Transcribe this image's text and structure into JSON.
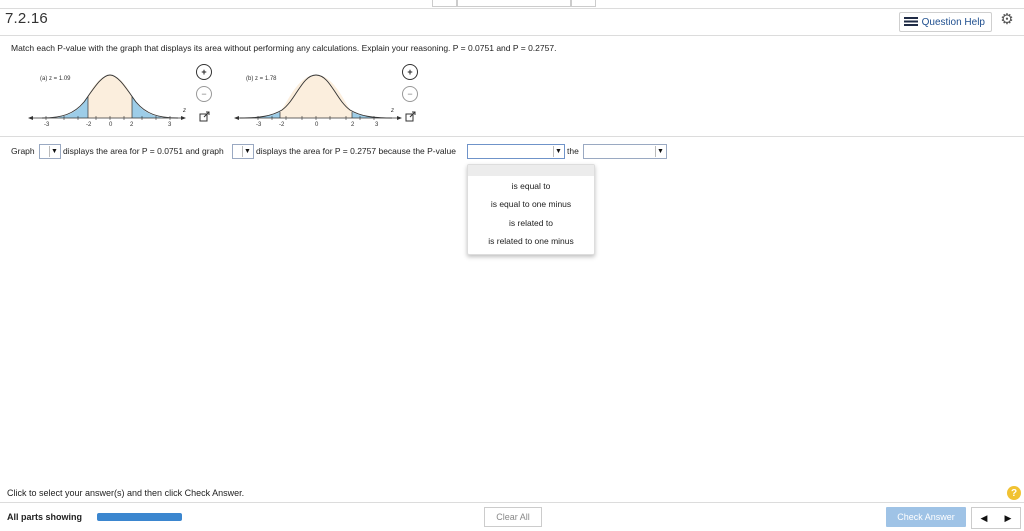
{
  "question": {
    "number": "7.2.16",
    "instruction": "Match each P-value with the graph that displays its area without performing any calculations. Explain your reasoning. P = 0.0751 and P = 0.2757."
  },
  "toolbar": {
    "help_label": "Question Help",
    "list_icon": "list-icon",
    "settings_icon": "gear-icon"
  },
  "graphs": [
    {
      "label": "(a) z = 1.09",
      "ticks": [
        "-3",
        "-2",
        "0",
        "2",
        "3"
      ],
      "axis_letter": "z"
    },
    {
      "label": "(b) z = 1.78",
      "ticks": [
        "-3",
        "-2",
        "0",
        "2",
        "3"
      ],
      "axis_letter": "z"
    }
  ],
  "answer": {
    "graph_word": "Graph",
    "text1": "displays the area for P = 0.0751 and graph",
    "text2": "displays the area for P = 0.2757 because the P-value",
    "text3": "the",
    "dropdown1_value": "",
    "dropdown2_value": "",
    "dropdown3_value": "",
    "dropdown4_value": ""
  },
  "menu_options": [
    "is equal to",
    "is equal to one minus",
    "is related to",
    "is related to one minus"
  ],
  "footer": {
    "message": "Click to select your answer(s) and then click Check Answer.",
    "parts_label": "All parts showing",
    "progress": 1.0,
    "clear_label": "Clear All",
    "check_label": "Check Answer",
    "help_symbol": "?"
  },
  "colors": {
    "shade_tail": "#9dcde8",
    "shade_middle": "#fbeedd",
    "progress": "#3b86cf",
    "check_button": "#9fc3e6"
  }
}
